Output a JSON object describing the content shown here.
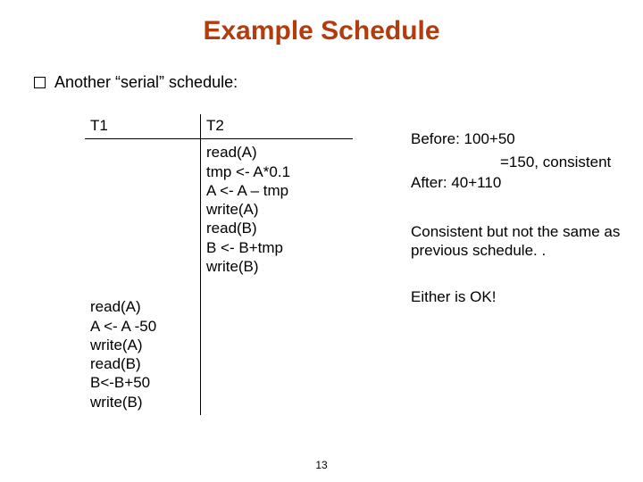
{
  "title": "Example Schedule",
  "bullet": "Another “serial” schedule:",
  "schedule": {
    "t1_header": "T1",
    "t2_header": "T2",
    "t2_ops": "read(A)\ntmp <- A*0.1\nA <- A – tmp\nwrite(A)\nread(B)\nB <- B+tmp\nwrite(B)",
    "t1_ops": "read(A)\nA <- A -50\nwrite(A)\nread(B)\nB<-B+50\nwrite(B)"
  },
  "notes": {
    "before": "Before: 100+50",
    "eq": "=150, consistent",
    "after": "After: 40+110",
    "consistent": "Consistent but not the same as previous schedule. .",
    "either": "Either is OK!"
  },
  "page_number": "13"
}
